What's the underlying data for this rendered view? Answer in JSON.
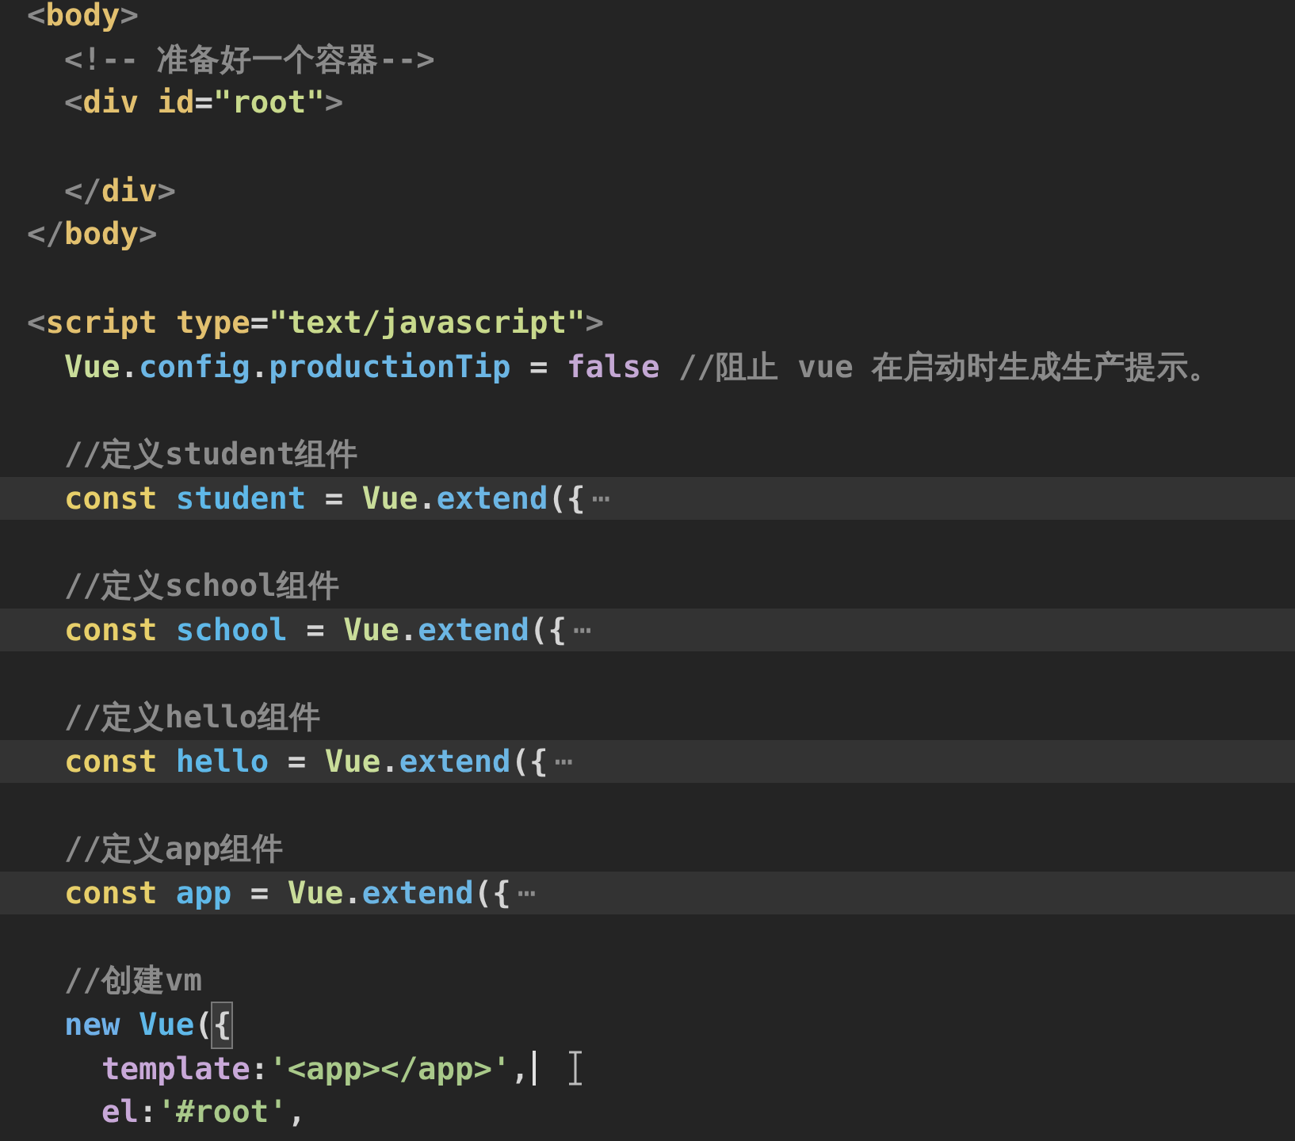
{
  "editor": {
    "lines": [
      {
        "highlighted": false,
        "cursor": false,
        "tokens": [
          {
            "text": "<",
            "kind": "punct"
          },
          {
            "text": "body",
            "kind": "tag"
          },
          {
            "text": ">",
            "kind": "punct"
          }
        ]
      },
      {
        "highlighted": false,
        "cursor": false,
        "tokens": [
          {
            "text": "  <!-- 准备好一个容器-->",
            "kind": "comment"
          }
        ]
      },
      {
        "highlighted": false,
        "cursor": false,
        "tokens": [
          {
            "text": "  <",
            "kind": "punct"
          },
          {
            "text": "div",
            "kind": "tag"
          },
          {
            "text": " id",
            "kind": "attr"
          },
          {
            "text": "=",
            "kind": "plain"
          },
          {
            "text": "\"root\"",
            "kind": "string"
          },
          {
            "text": ">",
            "kind": "punct"
          }
        ]
      },
      {
        "highlighted": false,
        "cursor": false
      },
      {
        "highlighted": false,
        "cursor": false,
        "tokens": [
          {
            "text": "  </",
            "kind": "punct"
          },
          {
            "text": "div",
            "kind": "tag"
          },
          {
            "text": ">",
            "kind": "punct"
          }
        ]
      },
      {
        "highlighted": false,
        "cursor": false,
        "tokens": [
          {
            "text": "</",
            "kind": "punct"
          },
          {
            "text": "body",
            "kind": "tag"
          },
          {
            "text": ">",
            "kind": "punct"
          }
        ]
      },
      {
        "highlighted": false,
        "cursor": false
      },
      {
        "highlighted": false,
        "cursor": false,
        "tokens": [
          {
            "text": "<",
            "kind": "punct"
          },
          {
            "text": "script",
            "kind": "tag"
          },
          {
            "text": " type",
            "kind": "attr"
          },
          {
            "text": "=",
            "kind": "plain"
          },
          {
            "text": "\"text/javascript\"",
            "kind": "string"
          },
          {
            "text": ">",
            "kind": "punct"
          }
        ]
      },
      {
        "highlighted": false,
        "cursor": false,
        "tokens": [
          {
            "text": "  Vue",
            "kind": "class"
          },
          {
            "text": ".",
            "kind": "plain"
          },
          {
            "text": "config",
            "kind": "method"
          },
          {
            "text": ".",
            "kind": "plain"
          },
          {
            "text": "productionTip",
            "kind": "method"
          },
          {
            "text": " = ",
            "kind": "plain"
          },
          {
            "text": "false",
            "kind": "boolean"
          },
          {
            "text": " //阻止 vue 在启动时生成生产提示。",
            "kind": "comment"
          }
        ]
      },
      {
        "highlighted": false,
        "cursor": false
      },
      {
        "highlighted": false,
        "cursor": false,
        "tokens": [
          {
            "text": "  //定义student组件",
            "kind": "comment"
          }
        ]
      },
      {
        "highlighted": true,
        "cursor": false,
        "tokens": [
          {
            "text": "  const",
            "kind": "keyword"
          },
          {
            "text": " student",
            "kind": "variable"
          },
          {
            "text": " = ",
            "kind": "plain"
          },
          {
            "text": "Vue",
            "kind": "class"
          },
          {
            "text": ".",
            "kind": "plain"
          },
          {
            "text": "extend",
            "kind": "method"
          },
          {
            "text": "({",
            "kind": "plain"
          },
          {
            "text": "⋯",
            "kind": "fold"
          }
        ]
      },
      {
        "highlighted": false,
        "cursor": false
      },
      {
        "highlighted": false,
        "cursor": false,
        "tokens": [
          {
            "text": "  //定义school组件",
            "kind": "comment"
          }
        ]
      },
      {
        "highlighted": true,
        "cursor": false,
        "tokens": [
          {
            "text": "  const",
            "kind": "keyword"
          },
          {
            "text": " school",
            "kind": "variable"
          },
          {
            "text": " = ",
            "kind": "plain"
          },
          {
            "text": "Vue",
            "kind": "class"
          },
          {
            "text": ".",
            "kind": "plain"
          },
          {
            "text": "extend",
            "kind": "method"
          },
          {
            "text": "({",
            "kind": "plain"
          },
          {
            "text": "⋯",
            "kind": "fold"
          }
        ]
      },
      {
        "highlighted": false,
        "cursor": false
      },
      {
        "highlighted": false,
        "cursor": false,
        "tokens": [
          {
            "text": "  //定义hello组件",
            "kind": "comment"
          }
        ]
      },
      {
        "highlighted": true,
        "cursor": false,
        "tokens": [
          {
            "text": "  const",
            "kind": "keyword"
          },
          {
            "text": " hello",
            "kind": "variable"
          },
          {
            "text": " = ",
            "kind": "plain"
          },
          {
            "text": "Vue",
            "kind": "class"
          },
          {
            "text": ".",
            "kind": "plain"
          },
          {
            "text": "extend",
            "kind": "method"
          },
          {
            "text": "({",
            "kind": "plain"
          },
          {
            "text": "⋯",
            "kind": "fold"
          }
        ]
      },
      {
        "highlighted": false,
        "cursor": false
      },
      {
        "highlighted": false,
        "cursor": false,
        "tokens": [
          {
            "text": "  //定义app组件",
            "kind": "comment"
          }
        ]
      },
      {
        "highlighted": true,
        "cursor": false,
        "tokens": [
          {
            "text": "  const",
            "kind": "keyword"
          },
          {
            "text": " app",
            "kind": "variable"
          },
          {
            "text": " = ",
            "kind": "plain"
          },
          {
            "text": "Vue",
            "kind": "class"
          },
          {
            "text": ".",
            "kind": "plain"
          },
          {
            "text": "extend",
            "kind": "method"
          },
          {
            "text": "({",
            "kind": "plain"
          },
          {
            "text": "⋯",
            "kind": "fold"
          }
        ]
      },
      {
        "highlighted": false,
        "cursor": false
      },
      {
        "highlighted": false,
        "cursor": false,
        "tokens": [
          {
            "text": "  //创建vm",
            "kind": "comment"
          }
        ]
      },
      {
        "highlighted": false,
        "cursor": false,
        "tokens": [
          {
            "text": "  new",
            "kind": "keyword2"
          },
          {
            "text": " Vue",
            "kind": "variable"
          },
          {
            "text": "(",
            "kind": "plain"
          },
          {
            "text": "{",
            "kind": "brace_match"
          }
        ]
      },
      {
        "highlighted": false,
        "cursor": true,
        "tokens": [
          {
            "text": "    template",
            "kind": "property"
          },
          {
            "text": ":",
            "kind": "plain"
          },
          {
            "text": "'<app></app>'",
            "kind": "string2"
          },
          {
            "text": ",",
            "kind": "plain"
          }
        ]
      },
      {
        "highlighted": false,
        "cursor": false,
        "tokens": [
          {
            "text": "    el",
            "kind": "property"
          },
          {
            "text": ":",
            "kind": "plain"
          },
          {
            "text": "'#root'",
            "kind": "string2"
          },
          {
            "text": ",",
            "kind": "plain"
          }
        ]
      }
    ]
  }
}
